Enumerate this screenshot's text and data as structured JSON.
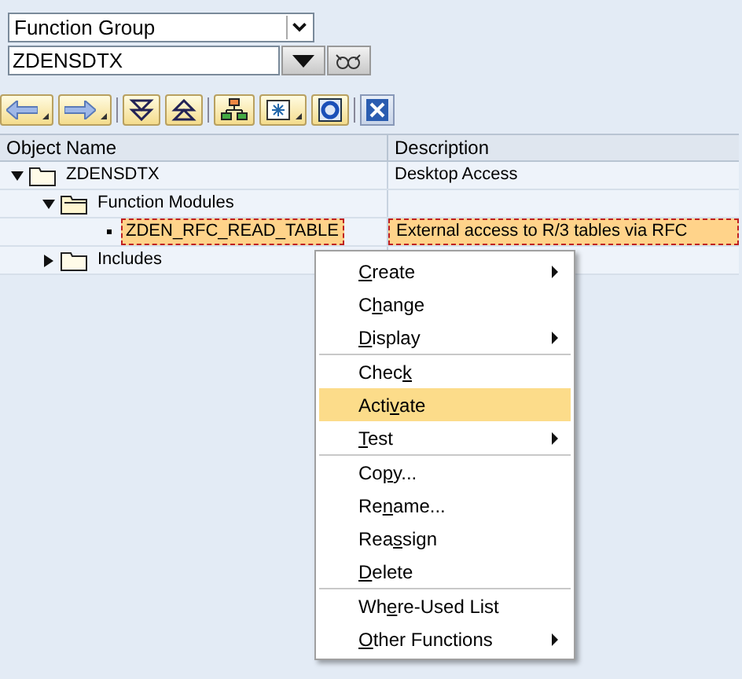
{
  "selector": {
    "type_value": "Function Group",
    "name_value": "ZDENSDTX"
  },
  "table": {
    "columns": [
      "Object Name",
      "Description"
    ],
    "tree": [
      {
        "name": "ZDENSDTX",
        "description": "Desktop Access",
        "kind": "folder",
        "expanded": true,
        "selected": false,
        "children": [
          {
            "name": "Function Modules",
            "kind": "open-folder",
            "expanded": true,
            "selected": false,
            "children": [
              {
                "name": "ZDEN_RFC_READ_TABLE",
                "description": "External access to R/3 tables via RFC",
                "kind": "leaf",
                "selected": true
              }
            ]
          },
          {
            "name": "Includes",
            "kind": "folder",
            "expanded": false,
            "selected": false
          }
        ]
      }
    ]
  },
  "context_menu": {
    "groups": [
      [
        {
          "key": "C",
          "post": "reate",
          "submenu": true,
          "selected": false
        },
        {
          "pre": "C",
          "key": "h",
          "post": "ange",
          "submenu": false,
          "selected": false
        },
        {
          "key": "D",
          "post": "isplay",
          "submenu": true,
          "selected": false
        }
      ],
      [
        {
          "pre": "Chec",
          "key": "k",
          "submenu": false,
          "selected": false
        },
        {
          "pre": "Acti",
          "key": "v",
          "post": "ate",
          "submenu": false,
          "selected": true
        },
        {
          "key": "T",
          "post": "est",
          "submenu": true,
          "selected": false
        }
      ],
      [
        {
          "pre": "Co",
          "key": "p",
          "post": "y...",
          "submenu": false,
          "selected": false
        },
        {
          "pre": "Re",
          "key": "n",
          "post": "ame...",
          "submenu": false,
          "selected": false
        },
        {
          "pre": "Rea",
          "key": "s",
          "post": "sign",
          "submenu": false,
          "selected": false
        },
        {
          "key": "D",
          "post": "elete",
          "submenu": false,
          "selected": false
        }
      ],
      [
        {
          "pre": "Wh",
          "key": "e",
          "post": "re-Used List",
          "submenu": false,
          "selected": false
        },
        {
          "key": "O",
          "post": "ther Functions",
          "submenu": true,
          "selected": false
        }
      ]
    ]
  }
}
